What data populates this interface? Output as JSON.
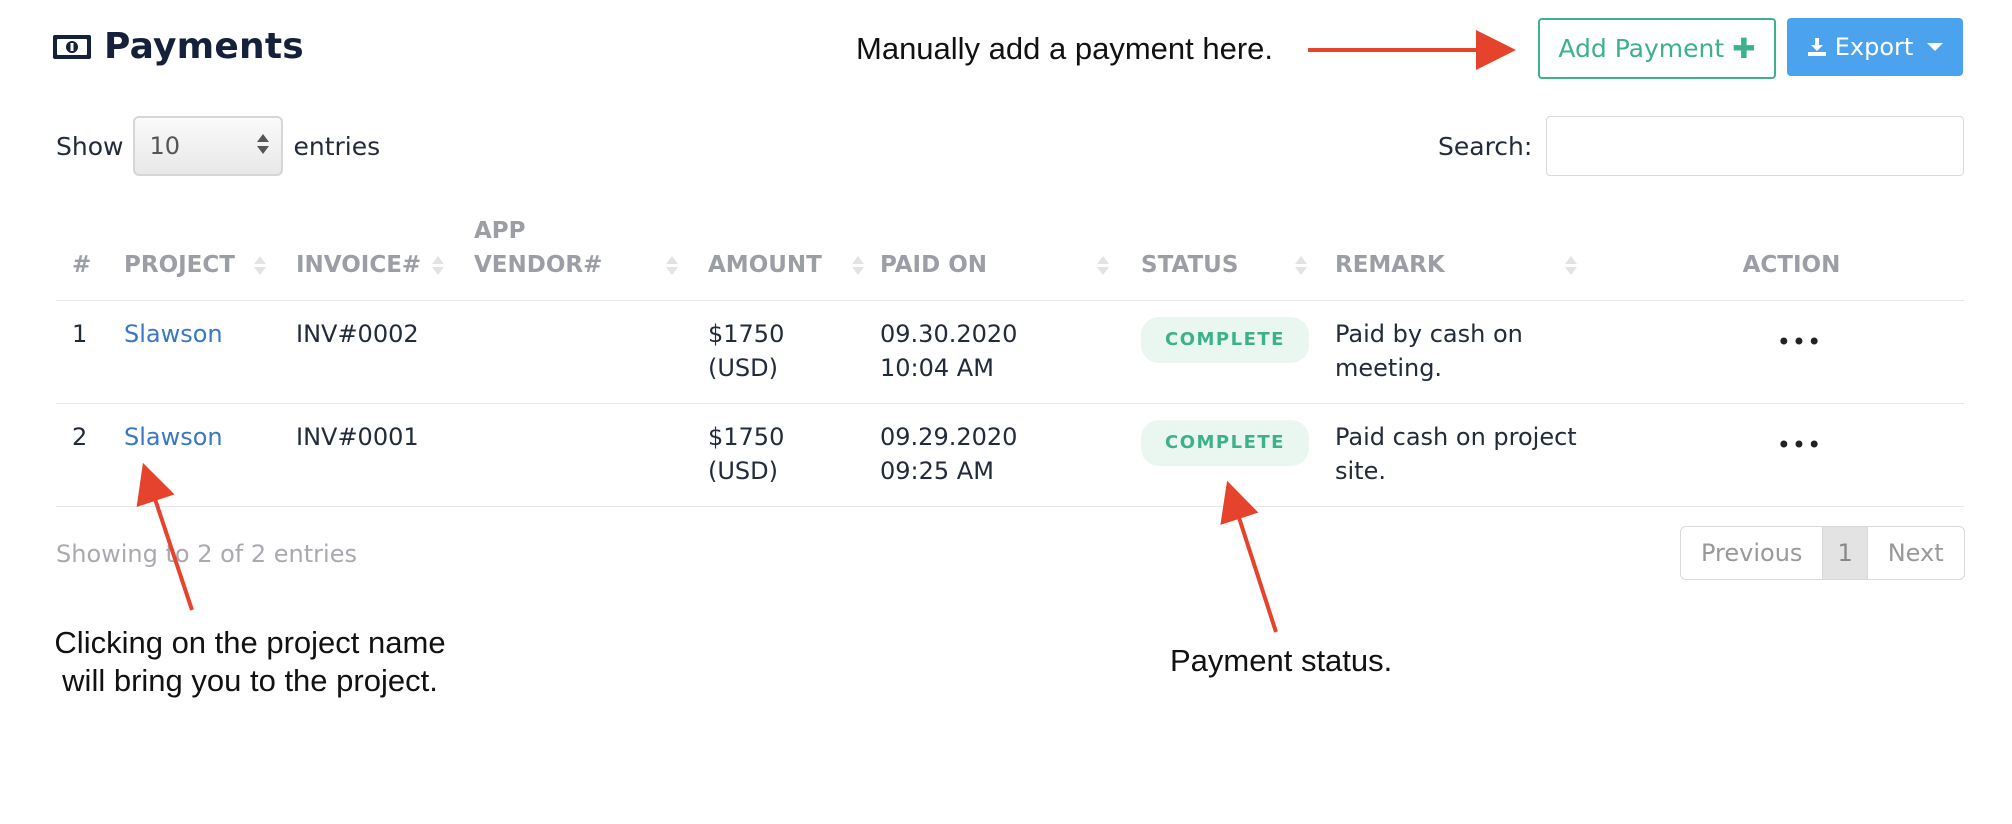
{
  "header": {
    "title": "Payments",
    "add_label": "Add Payment",
    "export_label": "Export"
  },
  "length": {
    "show_label": "Show",
    "value": "10",
    "entries_label": "entries"
  },
  "search": {
    "label": "Search:",
    "value": ""
  },
  "table": {
    "columns": [
      "#",
      "PROJECT",
      "INVOICE#",
      "APP VENDOR#",
      "AMOUNT",
      "PAID ON",
      "STATUS",
      "REMARK",
      "ACTION"
    ],
    "rows": [
      {
        "num": "1",
        "project": "Slawson",
        "invoice": "INV#0002",
        "vendor": "",
        "amount": "$1750 (USD)",
        "paid_on": "09.30.2020 10:04 AM",
        "status": "COMPLETE",
        "remark": "Paid by cash on meeting."
      },
      {
        "num": "2",
        "project": "Slawson",
        "invoice": "INV#0001",
        "vendor": "",
        "amount": "$1750 (USD)",
        "paid_on": "09.29.2020 09:25 AM",
        "status": "COMPLETE",
        "remark": "Paid cash on project site."
      }
    ]
  },
  "footer": {
    "info": "Showing   to 2 of 2 entries",
    "prev": "Previous",
    "page": "1",
    "next": "Next"
  },
  "annotations": {
    "add_note": "Manually add a payment here.",
    "project_note": "Clicking on the project name will bring you to the project.",
    "status_note": "Payment status."
  },
  "colors": {
    "accent_green": "#3db08c",
    "export_blue": "#4aa3ec",
    "link_blue": "#3a78c4",
    "arrow_red": "#e6432c"
  }
}
